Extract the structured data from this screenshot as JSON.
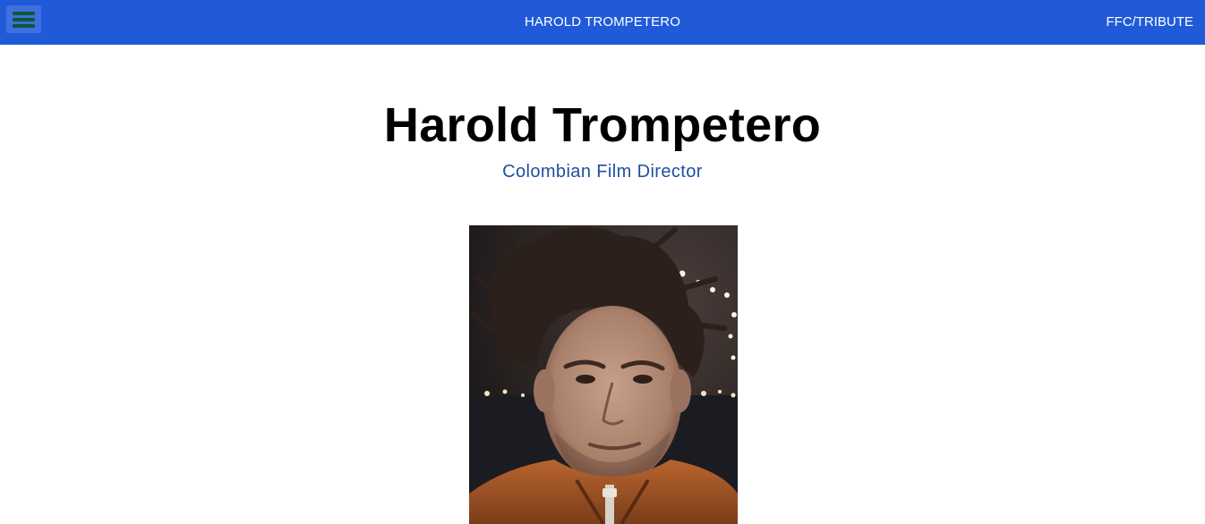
{
  "navbar": {
    "menu_icon": "hamburger-menu-icon",
    "title": "HAROLD TROMPETERO",
    "right_link": "FFC/TRIBUTE",
    "background_color": "#205ad9",
    "menu_button_color": "#3f6fe0",
    "menu_icon_color": "#0d5a37"
  },
  "main": {
    "heading": "Harold Trompetero",
    "subtitle": "Colombian Film Director",
    "subtitle_color": "#1f4f9e"
  },
  "portrait": {
    "alt": "Photo of Harold Trompetero"
  }
}
